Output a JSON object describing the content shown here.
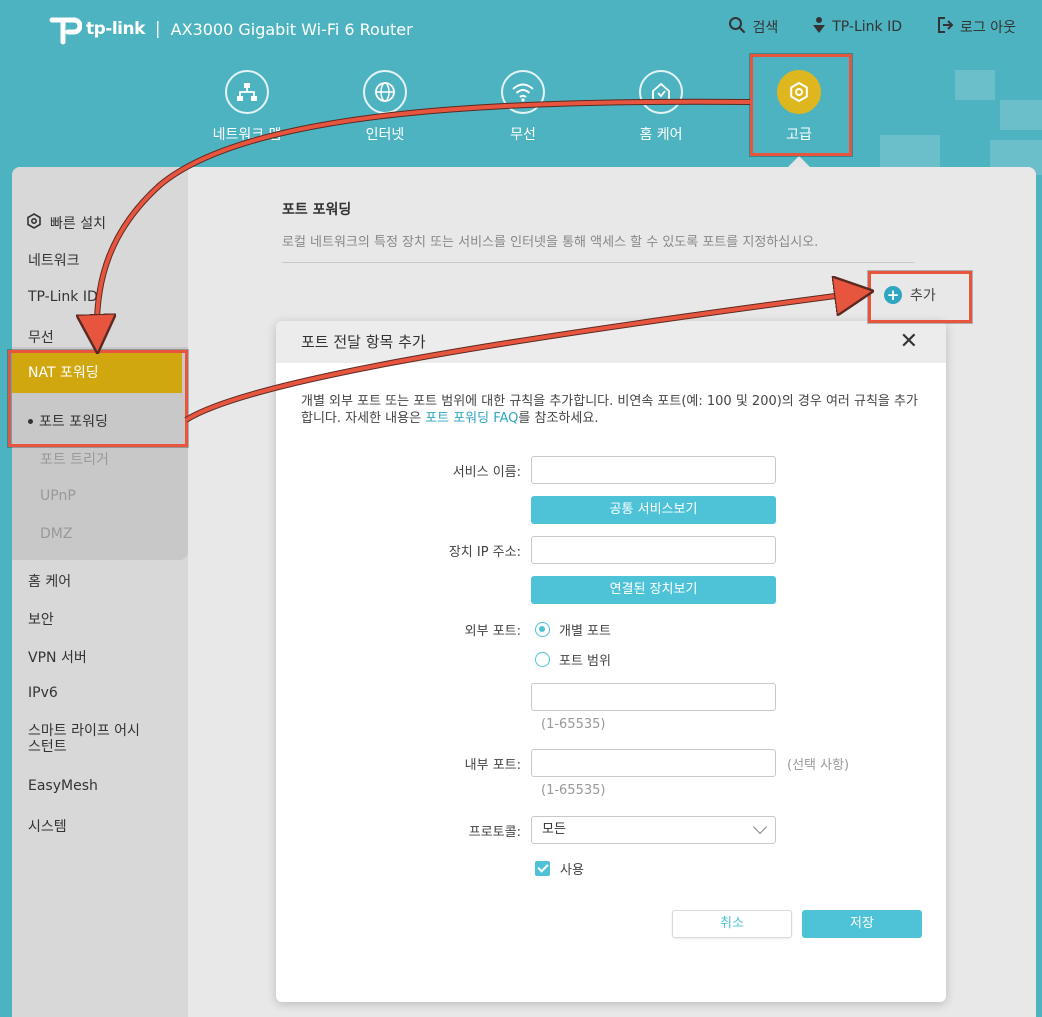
{
  "brand": {
    "logo_text": "tp-link",
    "separator": "|",
    "model": "AX3000 Gigabit Wi-Fi 6 Router"
  },
  "top_links": [
    {
      "label": "검색",
      "icon": "search-icon"
    },
    {
      "label": "TP-Link ID",
      "icon": "tplink-id-icon"
    },
    {
      "label": "로그 아웃",
      "icon": "logout-icon"
    }
  ],
  "nav": [
    {
      "label": "네트워크 맵",
      "icon": "network-map-icon"
    },
    {
      "label": "인터넷",
      "icon": "globe-icon"
    },
    {
      "label": "무선",
      "icon": "wifi-icon"
    },
    {
      "label": "홈 케어",
      "icon": "home-care-icon"
    },
    {
      "label": "고급",
      "icon": "gear-icon",
      "active": true
    }
  ],
  "sidebar": {
    "quick_setup": "빠른 설치",
    "items_top": [
      "네트워크",
      "TP-Link ID",
      "무선"
    ],
    "nat": "NAT 포워딩",
    "nat_sub": [
      "포트 포워딩",
      "포트 트리거",
      "UPnP",
      "DMZ"
    ],
    "items_bottom": [
      "홈 케어",
      "보안",
      "VPN 서버",
      "IPv6",
      "스마트 라이프 어시\n스턴트",
      "EasyMesh",
      "시스템"
    ]
  },
  "page": {
    "title": "포트 포워딩",
    "description": "로컬 네트워크의 특정 장치 또는 서비스를 인터넷을 통해 액세스 할 수 있도록 포트를 지정하십시오.",
    "add_label": "추가"
  },
  "modal": {
    "title": "포트 전달 항목 추가",
    "close": "✕",
    "desc_before": "개별 외부 포트 또는 포트 범위에 대한 규칙을 추가합니다. 비연속 포트(예: 100 및 200)의 경우 여러 규칙을 추가합니다. 자세한 내용은 ",
    "desc_link": "포트 포워딩 FAQ",
    "desc_after": "를 참조하세요.",
    "service_label": "서비스 이름:",
    "service_value": "",
    "common_services_btn": "공통 서비스보기",
    "device_ip_label": "장치 IP 주소:",
    "device_ip_value": "",
    "connected_devices_btn": "연결된 장치보기",
    "external_port_label": "외부 포트:",
    "radio_single": "개별 포트",
    "radio_range": "포트 범위",
    "external_port_value": "",
    "external_port_hint": "(1-65535)",
    "internal_port_label": "내부 포트:",
    "internal_port_value": "",
    "internal_port_optional": "(선택 사항)",
    "internal_port_hint": "(1-65535)",
    "protocol_label": "프로토콜:",
    "protocol_value": "모든",
    "enable_label": "사용",
    "cancel": "취소",
    "save": "저장"
  },
  "colors": {
    "header_teal": "#4eb3c0",
    "accent": "#4ec3d8",
    "nat_gold": "#d1a70f",
    "highlight": "#e8553f"
  }
}
